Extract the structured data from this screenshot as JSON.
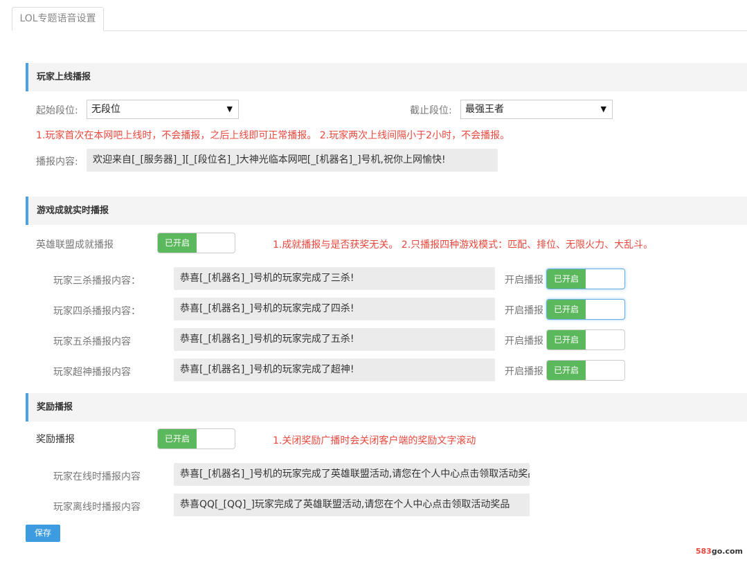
{
  "tab": {
    "label": "LOL专题语音设置"
  },
  "online": {
    "title": "玩家上线播报",
    "start_label": "起始段位:",
    "start_value": "无段位",
    "end_label": "截止段位:",
    "end_value": "最强王者",
    "note": "1.玩家首次在本网吧上线时，不会播报，之后上线即可正常播报。 2.玩家两次上线间隔小于2小时，不会播报。",
    "content_label": "播报内容:",
    "content_value": "欢迎来自[_[服务器]_][_[段位名]_]大神光临本网吧[_[机器名]_]号机,祝你上网愉快!"
  },
  "achieve": {
    "title": "游戏成就实时播报",
    "main_label": "英雄联盟成就播报",
    "main_toggle": "已开启",
    "note": "1.成就播报与是否获奖无关。 2.只播报四种游戏模式：匹配、排位、无限火力、大乱斗。",
    "enable_label": "开启播报",
    "rows": [
      {
        "label": "玩家三杀播报内容：",
        "value": "恭喜[_[机器名]_]号机的玩家完成了三杀!",
        "toggle": "已开启"
      },
      {
        "label": "玩家四杀播报内容：",
        "value": "恭喜[_[机器名]_]号机的玩家完成了四杀!",
        "toggle": "已开启"
      },
      {
        "label": "玩家五杀播报内容",
        "value": "恭喜[_[机器名]_]号机的玩家完成了五杀!",
        "toggle": "已开启"
      },
      {
        "label": "玩家超神播报内容",
        "value": "恭喜[_[机器名]_]号机的玩家完成了超神!",
        "toggle": "已开启"
      }
    ]
  },
  "reward": {
    "title": "奖励播报",
    "main_label": "奖励播报",
    "main_toggle": "已开启",
    "note": "1.关闭奖励广播时会关闭客户端的奖励文字滚动",
    "online_label": "玩家在线时播报内容",
    "online_value": "恭喜[_[机器名]_]号机的玩家完成了英雄联盟活动,请您在个人中心点击领取活动奖品",
    "offline_label": "玩家离线时播报内容",
    "offline_value": "恭喜QQ[_[QQ]_]玩家完成了英雄联盟活动,请您在个人中心点击领取活动奖品"
  },
  "save_label": "保存",
  "watermark": {
    "prefix": "583",
    "suffix": "go.com"
  },
  "colors": {
    "accent": "#4aa2e4",
    "toggle_on": "#5cb85c",
    "note": "#e8483d",
    "button": "#3d9be0"
  }
}
